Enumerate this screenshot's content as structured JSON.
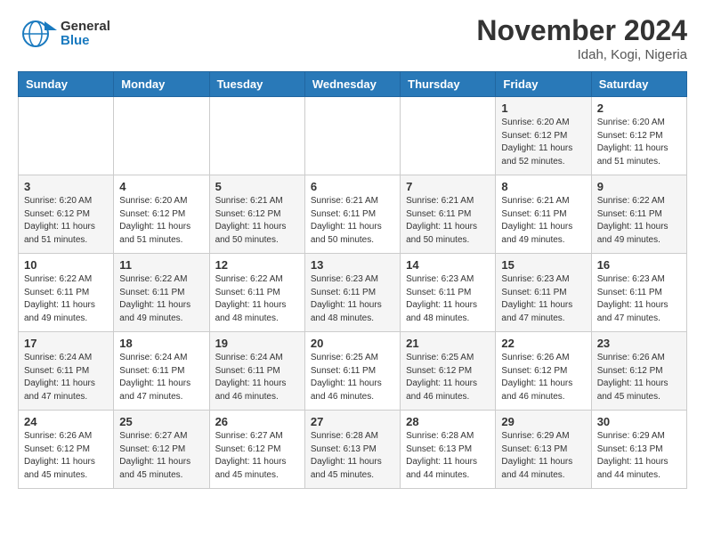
{
  "header": {
    "logo_general": "General",
    "logo_blue": "Blue",
    "month_title": "November 2024",
    "location": "Idah, Kogi, Nigeria"
  },
  "weekdays": [
    "Sunday",
    "Monday",
    "Tuesday",
    "Wednesday",
    "Thursday",
    "Friday",
    "Saturday"
  ],
  "weeks": [
    [
      {
        "day": "",
        "info": "",
        "shaded": false
      },
      {
        "day": "",
        "info": "",
        "shaded": false
      },
      {
        "day": "",
        "info": "",
        "shaded": false
      },
      {
        "day": "",
        "info": "",
        "shaded": false
      },
      {
        "day": "",
        "info": "",
        "shaded": false
      },
      {
        "day": "1",
        "info": "Sunrise: 6:20 AM\nSunset: 6:12 PM\nDaylight: 11 hours\nand 52 minutes.",
        "shaded": true
      },
      {
        "day": "2",
        "info": "Sunrise: 6:20 AM\nSunset: 6:12 PM\nDaylight: 11 hours\nand 51 minutes.",
        "shaded": false
      }
    ],
    [
      {
        "day": "3",
        "info": "Sunrise: 6:20 AM\nSunset: 6:12 PM\nDaylight: 11 hours\nand 51 minutes.",
        "shaded": true
      },
      {
        "day": "4",
        "info": "Sunrise: 6:20 AM\nSunset: 6:12 PM\nDaylight: 11 hours\nand 51 minutes.",
        "shaded": false
      },
      {
        "day": "5",
        "info": "Sunrise: 6:21 AM\nSunset: 6:12 PM\nDaylight: 11 hours\nand 50 minutes.",
        "shaded": true
      },
      {
        "day": "6",
        "info": "Sunrise: 6:21 AM\nSunset: 6:11 PM\nDaylight: 11 hours\nand 50 minutes.",
        "shaded": false
      },
      {
        "day": "7",
        "info": "Sunrise: 6:21 AM\nSunset: 6:11 PM\nDaylight: 11 hours\nand 50 minutes.",
        "shaded": true
      },
      {
        "day": "8",
        "info": "Sunrise: 6:21 AM\nSunset: 6:11 PM\nDaylight: 11 hours\nand 49 minutes.",
        "shaded": false
      },
      {
        "day": "9",
        "info": "Sunrise: 6:22 AM\nSunset: 6:11 PM\nDaylight: 11 hours\nand 49 minutes.",
        "shaded": true
      }
    ],
    [
      {
        "day": "10",
        "info": "Sunrise: 6:22 AM\nSunset: 6:11 PM\nDaylight: 11 hours\nand 49 minutes.",
        "shaded": false
      },
      {
        "day": "11",
        "info": "Sunrise: 6:22 AM\nSunset: 6:11 PM\nDaylight: 11 hours\nand 49 minutes.",
        "shaded": true
      },
      {
        "day": "12",
        "info": "Sunrise: 6:22 AM\nSunset: 6:11 PM\nDaylight: 11 hours\nand 48 minutes.",
        "shaded": false
      },
      {
        "day": "13",
        "info": "Sunrise: 6:23 AM\nSunset: 6:11 PM\nDaylight: 11 hours\nand 48 minutes.",
        "shaded": true
      },
      {
        "day": "14",
        "info": "Sunrise: 6:23 AM\nSunset: 6:11 PM\nDaylight: 11 hours\nand 48 minutes.",
        "shaded": false
      },
      {
        "day": "15",
        "info": "Sunrise: 6:23 AM\nSunset: 6:11 PM\nDaylight: 11 hours\nand 47 minutes.",
        "shaded": true
      },
      {
        "day": "16",
        "info": "Sunrise: 6:23 AM\nSunset: 6:11 PM\nDaylight: 11 hours\nand 47 minutes.",
        "shaded": false
      }
    ],
    [
      {
        "day": "17",
        "info": "Sunrise: 6:24 AM\nSunset: 6:11 PM\nDaylight: 11 hours\nand 47 minutes.",
        "shaded": true
      },
      {
        "day": "18",
        "info": "Sunrise: 6:24 AM\nSunset: 6:11 PM\nDaylight: 11 hours\nand 47 minutes.",
        "shaded": false
      },
      {
        "day": "19",
        "info": "Sunrise: 6:24 AM\nSunset: 6:11 PM\nDaylight: 11 hours\nand 46 minutes.",
        "shaded": true
      },
      {
        "day": "20",
        "info": "Sunrise: 6:25 AM\nSunset: 6:11 PM\nDaylight: 11 hours\nand 46 minutes.",
        "shaded": false
      },
      {
        "day": "21",
        "info": "Sunrise: 6:25 AM\nSunset: 6:12 PM\nDaylight: 11 hours\nand 46 minutes.",
        "shaded": true
      },
      {
        "day": "22",
        "info": "Sunrise: 6:26 AM\nSunset: 6:12 PM\nDaylight: 11 hours\nand 46 minutes.",
        "shaded": false
      },
      {
        "day": "23",
        "info": "Sunrise: 6:26 AM\nSunset: 6:12 PM\nDaylight: 11 hours\nand 45 minutes.",
        "shaded": true
      }
    ],
    [
      {
        "day": "24",
        "info": "Sunrise: 6:26 AM\nSunset: 6:12 PM\nDaylight: 11 hours\nand 45 minutes.",
        "shaded": false
      },
      {
        "day": "25",
        "info": "Sunrise: 6:27 AM\nSunset: 6:12 PM\nDaylight: 11 hours\nand 45 minutes.",
        "shaded": true
      },
      {
        "day": "26",
        "info": "Sunrise: 6:27 AM\nSunset: 6:12 PM\nDaylight: 11 hours\nand 45 minutes.",
        "shaded": false
      },
      {
        "day": "27",
        "info": "Sunrise: 6:28 AM\nSunset: 6:13 PM\nDaylight: 11 hours\nand 45 minutes.",
        "shaded": true
      },
      {
        "day": "28",
        "info": "Sunrise: 6:28 AM\nSunset: 6:13 PM\nDaylight: 11 hours\nand 44 minutes.",
        "shaded": false
      },
      {
        "day": "29",
        "info": "Sunrise: 6:29 AM\nSunset: 6:13 PM\nDaylight: 11 hours\nand 44 minutes.",
        "shaded": true
      },
      {
        "day": "30",
        "info": "Sunrise: 6:29 AM\nSunset: 6:13 PM\nDaylight: 11 hours\nand 44 minutes.",
        "shaded": false
      }
    ]
  ]
}
